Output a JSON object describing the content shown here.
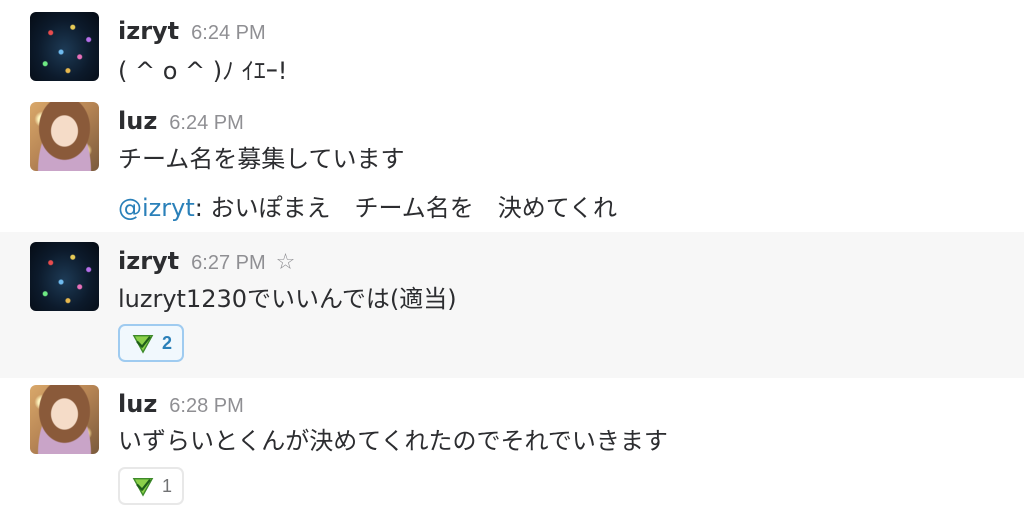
{
  "messages": [
    {
      "author": "izryt",
      "time": "6:24 PM",
      "avatar": "christmas-tree-lights-avatar",
      "lines": [
        "( ^ o ^ )ﾉ ｲｴｰ!"
      ]
    },
    {
      "author": "luz",
      "time": "6:24 PM",
      "avatar": "anime-girl-avatar",
      "lines": [
        "チーム名を募集しています"
      ],
      "mention_line": {
        "mention": "@izryt",
        "text": ": おいぽまえ　チーム名を　決めてくれ"
      }
    },
    {
      "author": "izryt",
      "time": "6:27 PM",
      "avatar": "christmas-tree-lights-avatar",
      "star_icon": "star-outline-icon",
      "lines": [
        "luzryt1230でいいんでは(適当)"
      ],
      "reaction": {
        "emoji": "green-checkmark-triangle-emoji",
        "count": "2",
        "reacted_by_me": true
      }
    },
    {
      "author": "luz",
      "time": "6:28 PM",
      "avatar": "anime-girl-avatar",
      "lines": [
        "いずらいとくんが決めてくれたのでそれでいきます"
      ],
      "reaction": {
        "emoji": "green-checkmark-triangle-emoji",
        "count": "1",
        "reacted_by_me": false
      }
    }
  ],
  "colors": {
    "mention": "#2a80b9",
    "timestamp": "#8f8f93",
    "hover_row": "#f7f7f7",
    "reaction_active_border": "#9fcbf0",
    "reaction_active_bg": "#f1f8fd"
  }
}
